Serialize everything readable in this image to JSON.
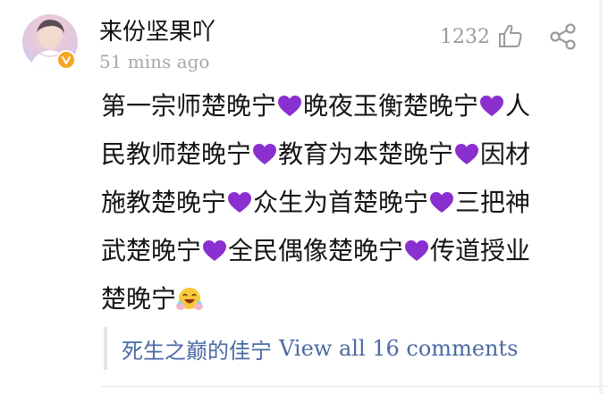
{
  "comment": {
    "username": "来份坚果吖",
    "time": "51  mins ago",
    "likes": "1232",
    "segments": [
      [
        "第一宗师楚晚宁",
        "heart",
        "晚夜玉衡楚晚宁",
        "heart",
        "人"
      ],
      [
        "民教师楚晚宁",
        "heart",
        "教育为本楚晚宁",
        "heart",
        "因材"
      ],
      [
        "施教楚晚宁",
        "heart",
        "众生为首楚晚宁",
        "heart",
        "三把神"
      ],
      [
        "武楚晚宁",
        "heart",
        "全民偶像楚晚宁",
        "heart",
        "传道授业"
      ],
      [
        "楚晚宁",
        "emoji"
      ]
    ]
  },
  "reply": {
    "user": "死生之巅的佳宁",
    "view_all": "View all 16 comments"
  },
  "colors": {
    "heart": "#8a2fd0",
    "link": "#4a6aa3",
    "meta": "#a8a8a8",
    "verified": "#f5a623"
  },
  "icons": {
    "like": "thumbs-up-icon",
    "share": "share-icon",
    "verified": "verified-badge-icon",
    "heart": "purple-heart-icon",
    "emoji": "grinning-hands-emoji-icon"
  }
}
